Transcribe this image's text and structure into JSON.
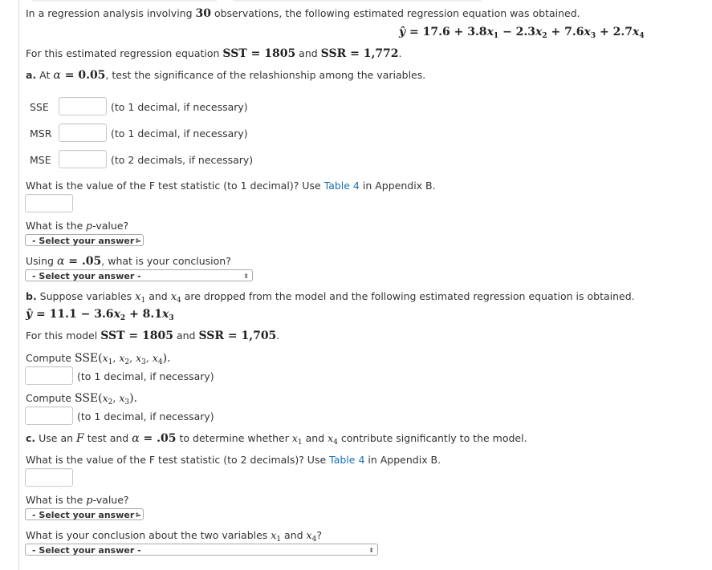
{
  "intro": {
    "text_before": "In a regression analysis involving ",
    "n_obs": "30",
    "text_after": " observations, the following estimated regression equation was obtained.",
    "equation": {
      "lhs": "ŷ",
      "terms": [
        "= 17.6 + 3.8",
        "− 2.3",
        "+ 7.6",
        "+ 2.7"
      ],
      "vars": [
        "x",
        "x",
        "x",
        "x"
      ],
      "subs": [
        "1",
        "2",
        "3",
        "4"
      ]
    },
    "sst_line": {
      "prefix": "For this estimated regression equation ",
      "sst": "SST = 1805",
      "and": " and ",
      "ssr": "SSR = 1,772",
      "suffix": "."
    }
  },
  "part_a": {
    "label": "a.",
    "text_prefix": " At ",
    "alpha": "α",
    "alpha_value": " = 0.05",
    "text_suffix": ", test the significance of the relashionship among the variables.",
    "fields": [
      {
        "label": "SSE",
        "value": "",
        "note": "(to 1 decimal, if necessary)"
      },
      {
        "label": "MSR",
        "value": "",
        "note": "(to 1 decimal, if necessary)"
      },
      {
        "label": "MSE",
        "value": "",
        "note": "(to 2 decimals, if necessary)"
      }
    ],
    "f_question": {
      "prefix": "What is the value of the F test statistic (to 1 decimal)? Use ",
      "link": "Table 4",
      "suffix": " in Appendix B.",
      "value": ""
    },
    "p_question": {
      "prefix": "What is the ",
      "p": "p",
      "suffix": "-value?",
      "select": "- Select your answer -"
    },
    "conclusion": {
      "prefix": "Using ",
      "alpha": "α",
      "alpha_value": " = .05",
      "suffix": ", what is your conclusion?",
      "select": "- Select your answer -"
    }
  },
  "part_b": {
    "label": "b.",
    "text_1": " Suppose variables ",
    "text_2": " and ",
    "text_3": " are dropped from the model and the following estimated regression equation is obtained.",
    "vars": [
      "x",
      "x"
    ],
    "subs": [
      "1",
      "4"
    ],
    "equation": {
      "lhs": "ŷ",
      "terms": [
        "= 11.1 − 3.6",
        "+ 8.1"
      ],
      "vars": [
        "x",
        "x"
      ],
      "subs": [
        "2",
        "3"
      ]
    },
    "model_line": {
      "prefix": "For this model ",
      "sst": "SST = 1805",
      "and": " and ",
      "ssr": "SSR = 1,705",
      "suffix": "."
    },
    "compute_full": {
      "prefix": "Compute ",
      "expr": "SSE(",
      "vars": [
        "x",
        "x",
        "x",
        "x"
      ],
      "subs": [
        "1",
        "2",
        "3",
        "4"
      ],
      "close": ").",
      "value": "",
      "note": "(to 1 decimal, if necessary)"
    },
    "compute_reduced": {
      "prefix": "Compute ",
      "expr": "SSE(",
      "vars": [
        "x",
        "x"
      ],
      "subs": [
        "2",
        "3"
      ],
      "close": ").",
      "value": "",
      "note": "(to 1 decimal, if necessary)"
    }
  },
  "part_c": {
    "label": "c.",
    "text_1": " Use an ",
    "F": "F",
    "text_2": " test and ",
    "alpha": "α",
    "alpha_value": " = .05",
    "text_3": " to determine whether ",
    "vars": [
      "x",
      "x"
    ],
    "subs": [
      "1",
      "4"
    ],
    "and": " and ",
    "text_4": " contribute significantly to the model.",
    "f_question": {
      "prefix": "What is the value of the F test statistic (to 2 decimals)? Use ",
      "link": "Table 4",
      "suffix": " in Appendix B.",
      "value": ""
    },
    "p_question": {
      "prefix": "What is the ",
      "p": "p",
      "suffix": "-value?",
      "select": "- Select your answer -"
    },
    "conclusion": {
      "prefix": "What is your conclusion about the two variables ",
      "vars": [
        "x",
        "x"
      ],
      "subs": [
        "1",
        "4"
      ],
      "and": " and ",
      "suffix": "?",
      "select": "- Select your answer -"
    }
  },
  "colors": {
    "link": "#1a6fb5",
    "text": "#333333",
    "input_border": "#c9c9c9"
  }
}
